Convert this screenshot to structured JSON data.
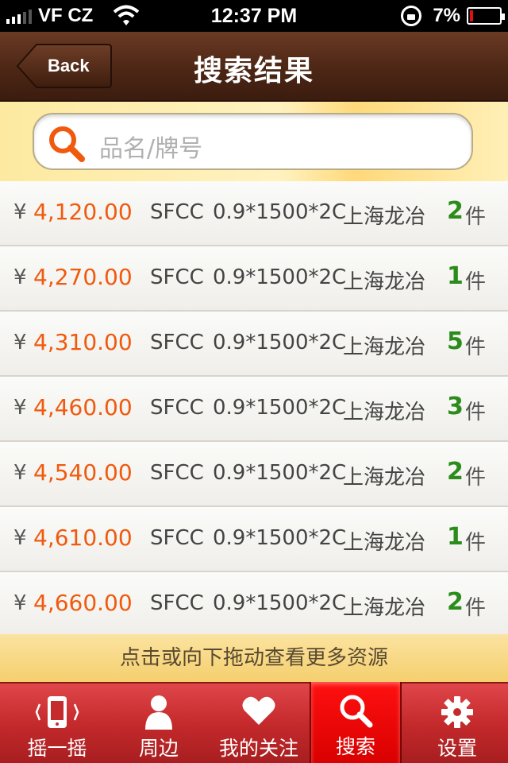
{
  "status_bar": {
    "carrier": "VF CZ",
    "time": "12:37 PM",
    "battery": "7%"
  },
  "nav": {
    "back_label": "Back",
    "title": "搜索结果"
  },
  "search": {
    "placeholder": "品名/牌号"
  },
  "results": [
    {
      "yen": "¥",
      "price": "4,120.00",
      "brand": "SFCC",
      "spec": "0.9*1500*2C",
      "maker": "上海龙冶",
      "qty": "2",
      "unit": "件"
    },
    {
      "yen": "¥",
      "price": "4,270.00",
      "brand": "SFCC",
      "spec": "0.9*1500*2C",
      "maker": "上海龙冶",
      "qty": "1",
      "unit": "件"
    },
    {
      "yen": "¥",
      "price": "4,310.00",
      "brand": "SFCC",
      "spec": "0.9*1500*2C",
      "maker": "上海龙冶",
      "qty": "5",
      "unit": "件"
    },
    {
      "yen": "¥",
      "price": "4,460.00",
      "brand": "SFCC",
      "spec": "0.9*1500*2C",
      "maker": "上海龙冶",
      "qty": "3",
      "unit": "件"
    },
    {
      "yen": "¥",
      "price": "4,540.00",
      "brand": "SFCC",
      "spec": "0.9*1500*2C",
      "maker": "上海龙冶",
      "qty": "2",
      "unit": "件"
    },
    {
      "yen": "¥",
      "price": "4,610.00",
      "brand": "SFCC",
      "spec": "0.9*1500*2C",
      "maker": "上海龙冶",
      "qty": "1",
      "unit": "件"
    },
    {
      "yen": "¥",
      "price": "4,660.00",
      "brand": "SFCC",
      "spec": "0.9*1500*2C",
      "maker": "上海龙冶",
      "qty": "2",
      "unit": "件"
    }
  ],
  "more_hint": "点击或向下拖动查看更多资源",
  "tabs": [
    {
      "label": "摇一摇",
      "icon": "phone-shake-icon"
    },
    {
      "label": "周边",
      "icon": "person-icon"
    },
    {
      "label": "我的关注",
      "icon": "heart-icon"
    },
    {
      "label": "搜索",
      "icon": "search-icon",
      "active": true
    },
    {
      "label": "设置",
      "icon": "gear-icon"
    }
  ],
  "colors": {
    "price": "#f05a0e",
    "qty": "#2b8c1b",
    "nav": "#4f2816",
    "tab_bar": "#c52a2c",
    "tab_active": "#e00000"
  }
}
